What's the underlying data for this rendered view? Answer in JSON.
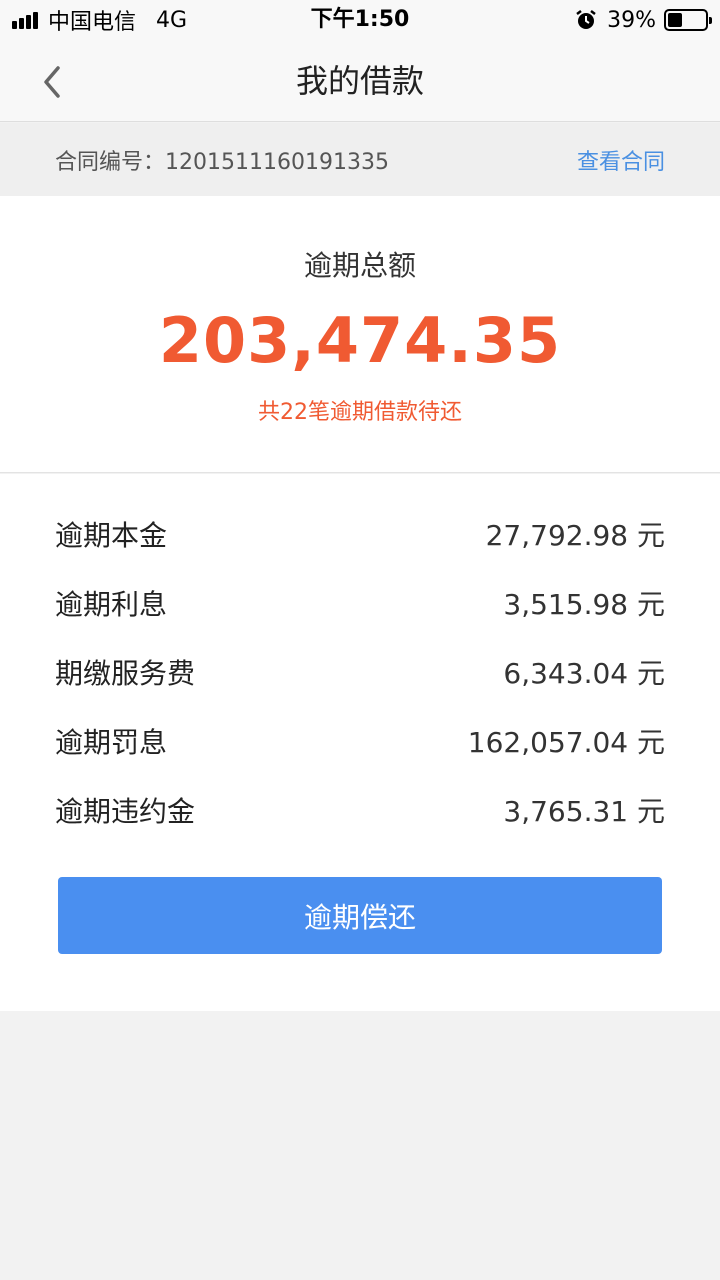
{
  "status_bar": {
    "carrier": "中国电信",
    "network": "4G",
    "time": "下午1:50",
    "battery_percent": "39%",
    "battery_level": 0.39,
    "icons": [
      "signal-icon",
      "alarm-icon",
      "battery-icon"
    ]
  },
  "nav": {
    "title": "我的借款",
    "back_icon": "chevron-left-icon"
  },
  "contract": {
    "label": "合同编号：1201511160191335",
    "view_link": "查看合同"
  },
  "summary": {
    "title": "逾期总额",
    "amount": "203,474.35",
    "subtitle": "共22笔逾期借款待还"
  },
  "details": [
    {
      "label": "逾期本金",
      "value": "27,792.98 元"
    },
    {
      "label": "逾期利息",
      "value": "3,515.98 元"
    },
    {
      "label": "期缴服务费",
      "value": "6,343.04 元"
    },
    {
      "label": "逾期罚息",
      "value": "162,057.04 元"
    },
    {
      "label": "逾期违约金",
      "value": "3,765.31 元"
    }
  ],
  "pay_button": "逾期偿还",
  "colors": {
    "accent_blue": "#4a8ff0",
    "link_blue": "#4a90e2",
    "overdue_red": "#f05a32"
  }
}
